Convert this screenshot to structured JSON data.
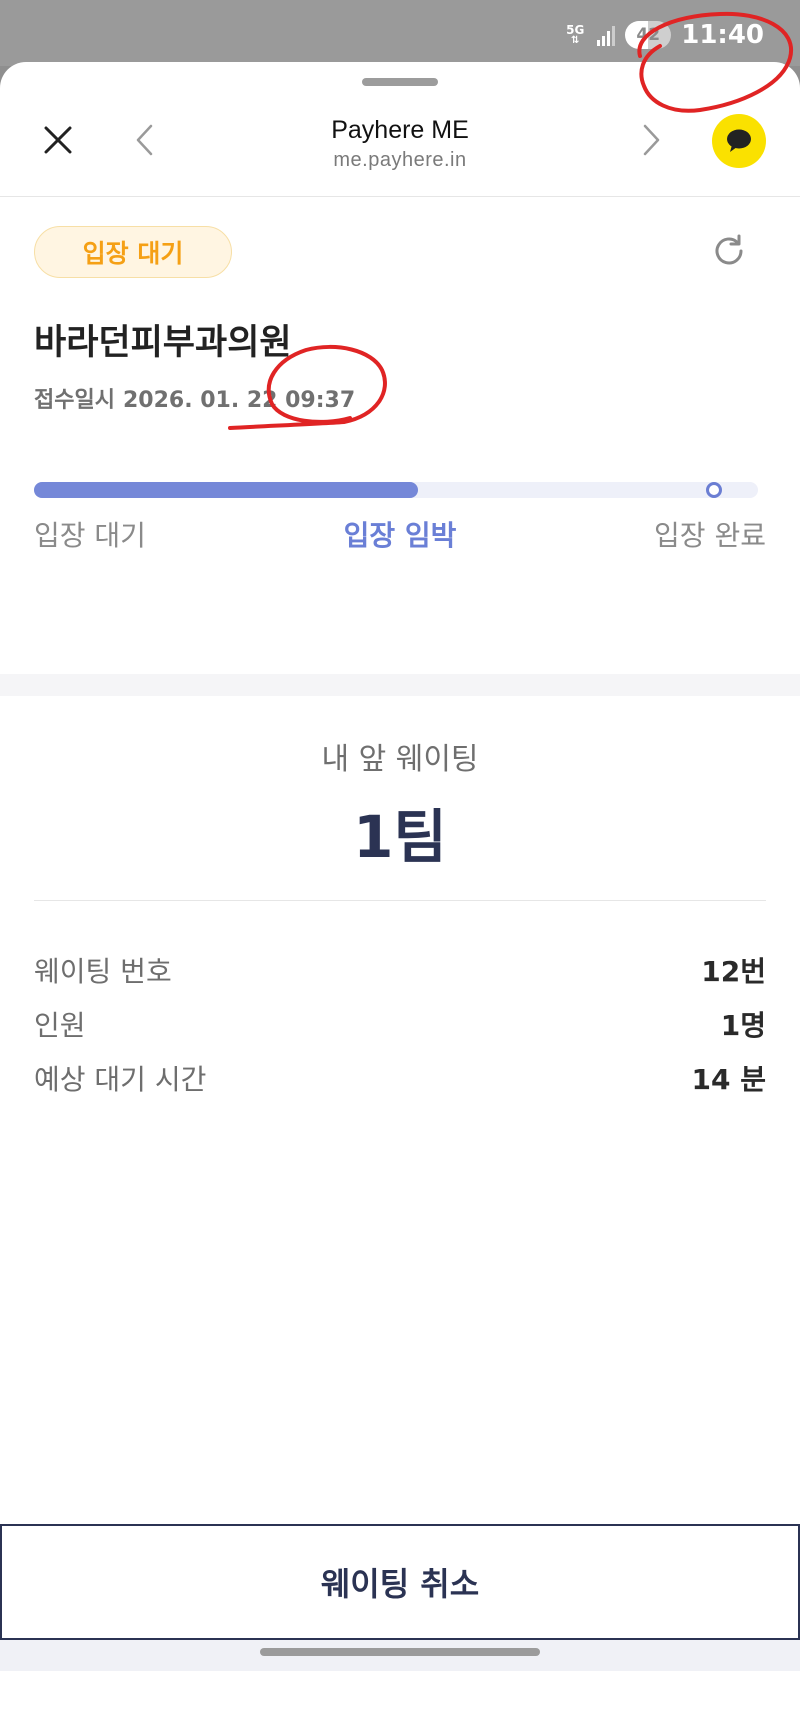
{
  "status_bar": {
    "network": "5G",
    "battery": "42",
    "time": "11:40"
  },
  "header": {
    "title": "Payhere ME",
    "url": "me.payhere.in",
    "icons": {
      "close": "close-icon",
      "back": "chevron-left-icon",
      "forward": "chevron-right-icon",
      "chat": "kakao-chat-icon"
    }
  },
  "status_badge": "입장 대기",
  "clinic": {
    "name": "바라던피부과의원",
    "received_label": "접수일시",
    "received_datetime": "2026. 01. 22 09:37"
  },
  "progress": {
    "fraction": 0.53,
    "steps": [
      "입장 대기",
      "입장 임박",
      "입장 완료"
    ],
    "active_step": 1
  },
  "queue": {
    "ahead_label": "내 앞 웨이팅",
    "ahead_value": "1팀"
  },
  "details": [
    {
      "label": "웨이팅 번호",
      "value": "12번"
    },
    {
      "label": "인원",
      "value": "1명"
    },
    {
      "label": "예상 대기 시간",
      "value": "14 분"
    }
  ],
  "cancel_button": "웨이팅 취소",
  "colors": {
    "accent": "#7588d8",
    "badge_text": "#f5a015",
    "badge_bg": "#fff5e2",
    "dark_navy": "#2b3353",
    "kakao_yellow": "#fae100",
    "annotation_red": "#e02424"
  }
}
